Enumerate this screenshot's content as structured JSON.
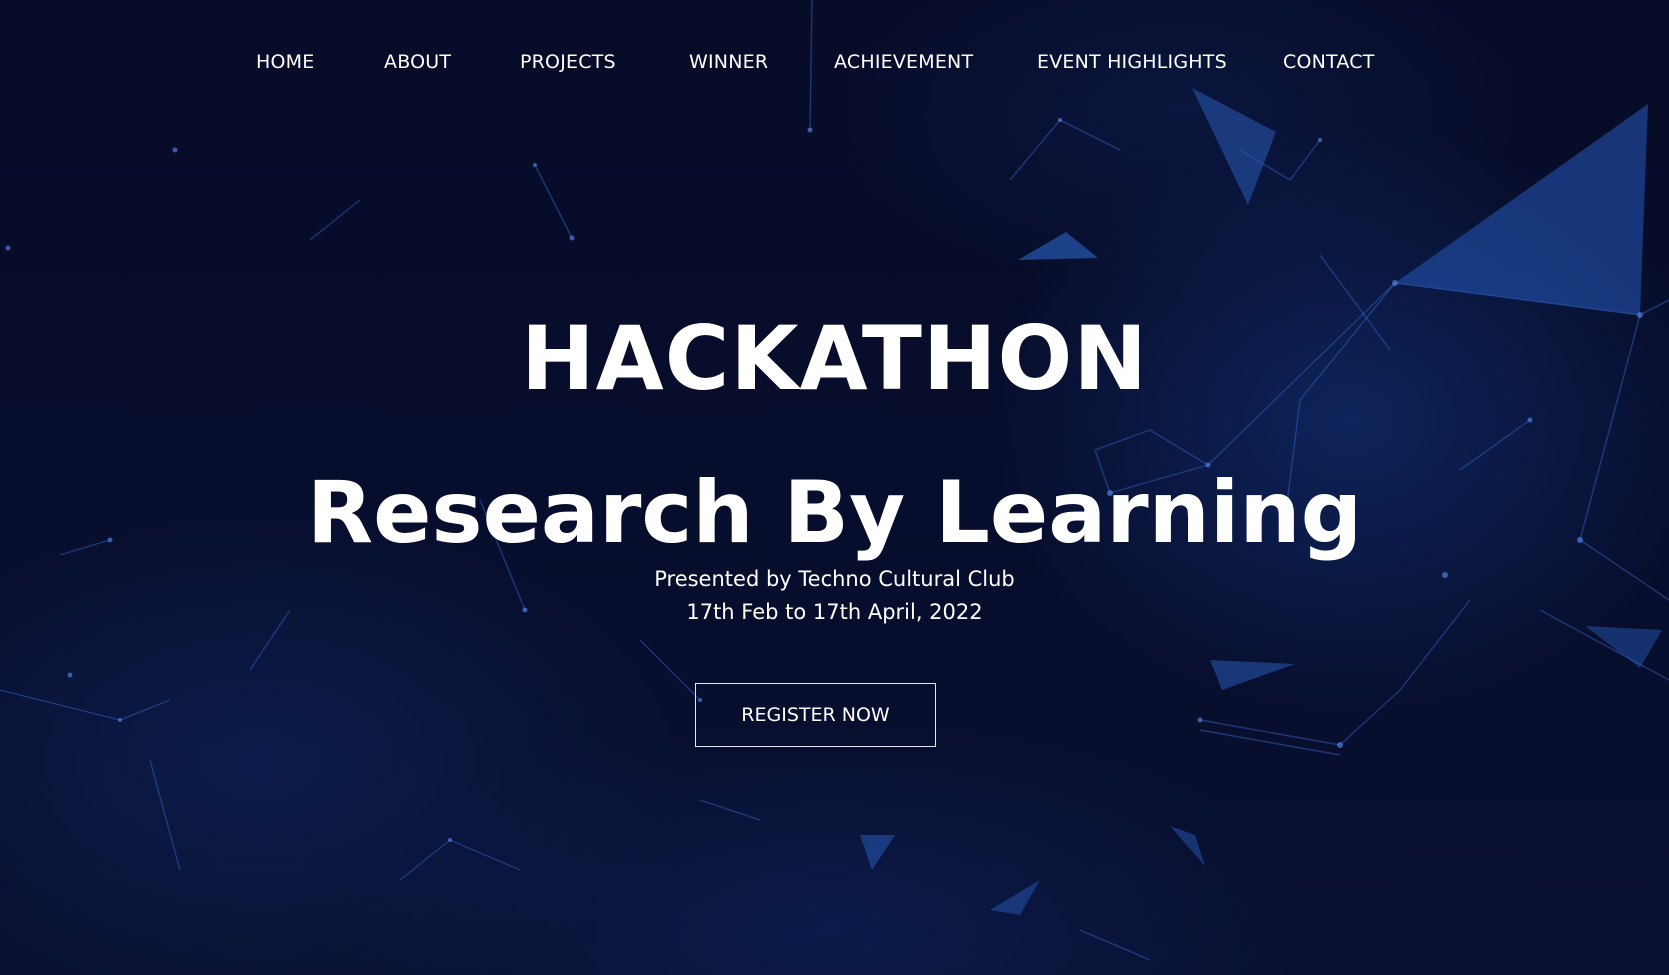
{
  "nav": {
    "items": [
      {
        "label": "HOME"
      },
      {
        "label": "ABOUT"
      },
      {
        "label": "PROJECTS"
      },
      {
        "label": "WINNER"
      },
      {
        "label": "ACHIEVEMENT"
      },
      {
        "label": "EVENT HIGHLIGHTS"
      },
      {
        "label": "CONTACT"
      }
    ]
  },
  "hero": {
    "title": "HACKATHON",
    "subtitle": "Research By Learning",
    "presented_by": "Presented by Techno Cultural Club",
    "dates": "17th Feb to 17th April, 2022",
    "cta_label": "REGISTER NOW"
  },
  "colors": {
    "background": "#060b24",
    "network_lines": "#2d5bb5",
    "text": "#ffffff"
  }
}
